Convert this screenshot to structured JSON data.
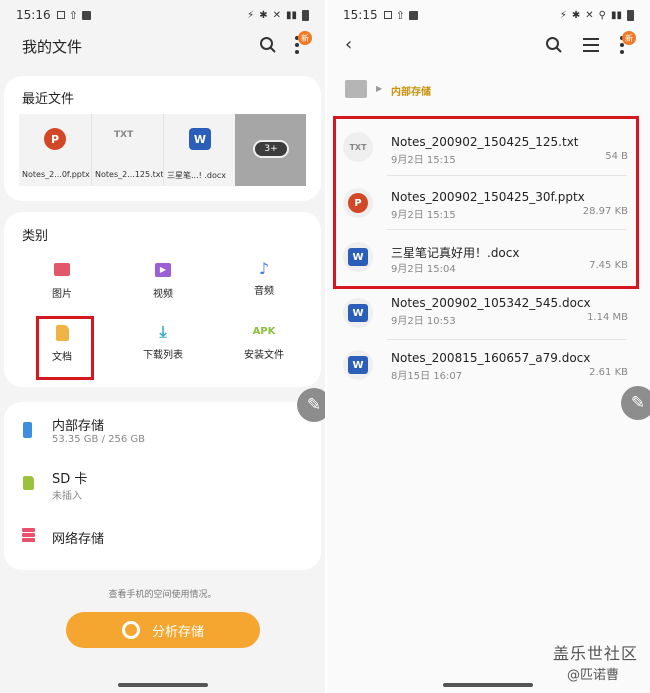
{
  "left": {
    "status": {
      "time": "15:16"
    },
    "header": {
      "title": "我的文件",
      "badge": "新"
    },
    "recent": {
      "title": "最近文件",
      "items": [
        {
          "name": "Notes_2...0f.pptx",
          "icon": "pptx-icon"
        },
        {
          "name": "Notes_2...125.txt",
          "icon": "txt-icon",
          "icon_text": "TXT"
        },
        {
          "name": "三星笔...! .docx",
          "icon": "docx-icon"
        },
        {
          "more_label": "3+"
        }
      ]
    },
    "categories": {
      "title": "类别",
      "items": [
        {
          "label": "图片",
          "icon": "image-icon",
          "color": "#e2586a"
        },
        {
          "label": "视频",
          "icon": "video-icon",
          "color": "#9c5fd6"
        },
        {
          "label": "音频",
          "icon": "audio-icon",
          "color": "#4a7fd8"
        },
        {
          "label": "文档",
          "icon": "document-icon",
          "color": "#f0b446"
        },
        {
          "label": "下载列表",
          "icon": "download-icon",
          "color": "#33aec6"
        },
        {
          "label": "安装文件",
          "icon": "apk-icon",
          "icon_text": "APK",
          "color": "#8cbf3c"
        }
      ]
    },
    "storage": [
      {
        "label": "内部存储",
        "sub": "53.35 GB / 256 GB",
        "icon": "phone-icon",
        "color": "#3d8ede"
      },
      {
        "label": "SD 卡",
        "sub": "未插入",
        "icon": "sdcard-icon",
        "color": "#9ac23c"
      },
      {
        "label": "网络存储",
        "sub": "",
        "icon": "network-storage-icon",
        "color": "#e8506c"
      }
    ],
    "footer": {
      "hint": "查看手机的空间使用情况。",
      "analyze_label": "分析存储"
    }
  },
  "right": {
    "status": {
      "time": "15:15"
    },
    "header": {
      "badge": "新"
    },
    "breadcrumb": {
      "label": "内部存储"
    },
    "files": [
      {
        "name": "Notes_200902_150425_125.txt",
        "date": "9月2日 15:15",
        "size": "54 B",
        "type": "txt",
        "icon_text": "TXT"
      },
      {
        "name": "Notes_200902_150425_30f.pptx",
        "date": "9月2日 15:15",
        "size": "28.97 KB",
        "type": "pptx"
      },
      {
        "name": "三星笔记真好用！.docx",
        "date": "9月2日 15:04",
        "size": "7.45 KB",
        "type": "docx"
      },
      {
        "name": "Notes_200902_105342_545.docx",
        "date": "9月2日 10:53",
        "size": "1.14 MB",
        "type": "docx"
      },
      {
        "name": "Notes_200815_160657_a79.docx",
        "date": "8月15日 16:07",
        "size": "2.61 KB",
        "type": "docx"
      }
    ],
    "watermark": {
      "line1": "盖乐世社区",
      "line2": "@匹诺曹"
    }
  },
  "colors": {
    "accent": "#f4a630",
    "highlight": "#d7171f",
    "breadcrumb": "#c9920a",
    "word_blue": "#2b5eb8",
    "ppt_red": "#d24726"
  }
}
